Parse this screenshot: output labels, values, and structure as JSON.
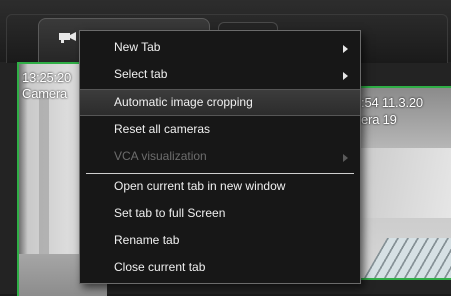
{
  "cameras": {
    "left": {
      "timestamp": "13:25:20",
      "name": "Camera"
    },
    "right": {
      "timestamp": "4:54  11.3.20",
      "name": "nera 19"
    }
  },
  "tab": {
    "icon": "camera-icon"
  },
  "context_menu": {
    "items": [
      {
        "label": "New Tab",
        "submenu": true,
        "enabled": true
      },
      {
        "label": "Select tab",
        "submenu": true,
        "enabled": true
      },
      {
        "label": "Automatic image cropping",
        "submenu": false,
        "enabled": true,
        "highlighted": true
      },
      {
        "label": "Reset all cameras",
        "submenu": false,
        "enabled": true
      },
      {
        "label": "VCA visualization",
        "submenu": true,
        "enabled": false
      },
      {
        "label": "Open current tab in new window",
        "submenu": false,
        "enabled": true
      },
      {
        "label": "Set tab to full Screen",
        "submenu": false,
        "enabled": true
      },
      {
        "label": "Rename tab",
        "submenu": false,
        "enabled": true
      },
      {
        "label": "Close current tab",
        "submenu": false,
        "enabled": true
      }
    ]
  },
  "colors": {
    "active_border": "#2fae46",
    "menu_background": "#171717",
    "disabled_text": "#6d6d6d"
  }
}
